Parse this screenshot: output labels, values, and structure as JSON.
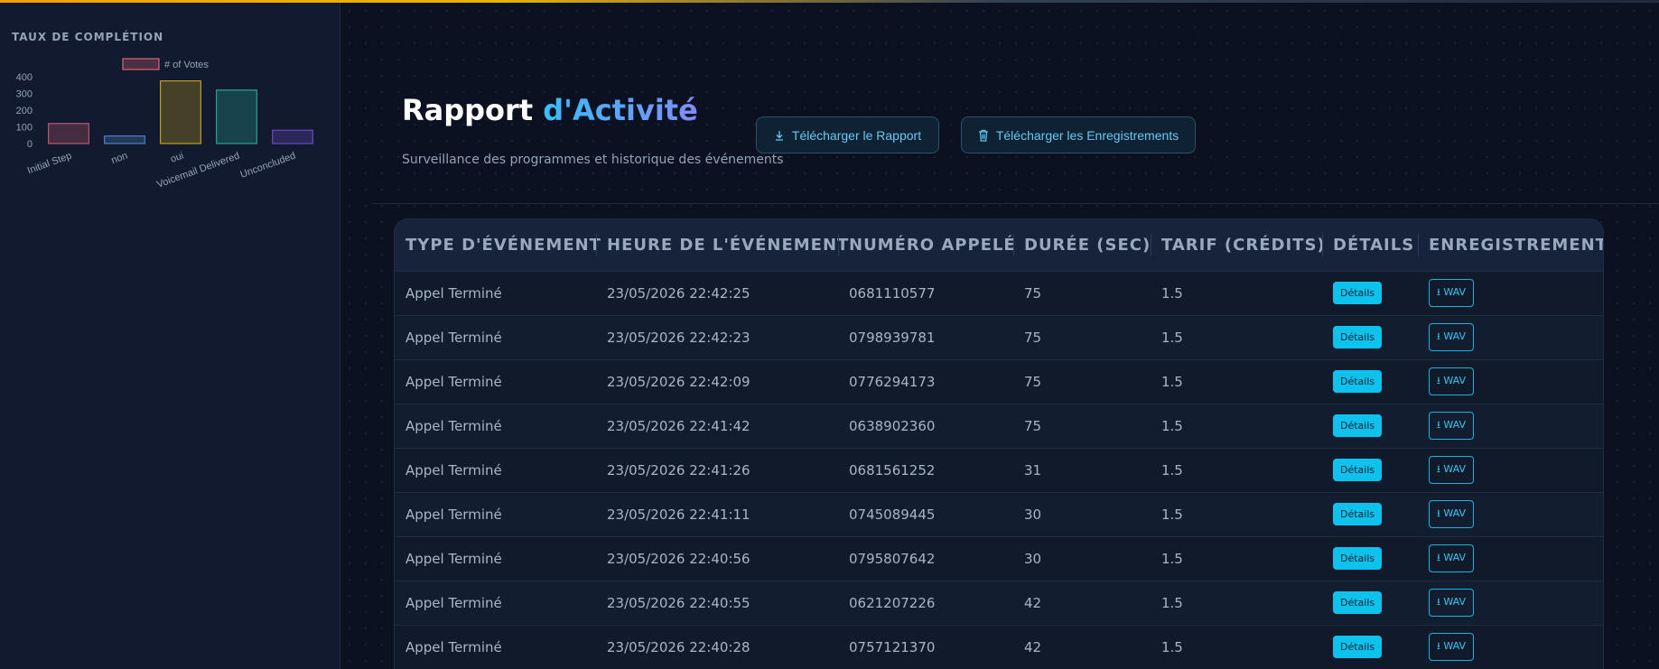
{
  "sidebar": {
    "title": "TAUX DE COMPLÉTION"
  },
  "chart_data": {
    "type": "bar",
    "legend": "# of Votes",
    "legend_position": "top",
    "categories": [
      "Initial Step",
      "non",
      "oui",
      "Voicemail Delivered",
      "Unconcluded"
    ],
    "values": [
      120,
      45,
      375,
      320,
      80
    ],
    "yticks": [
      0,
      100,
      200,
      300,
      400
    ],
    "ylim": [
      0,
      400
    ],
    "colors": [
      "#fb7185",
      "#60a5fa",
      "#facc15",
      "#2dd4bf",
      "#8b5cf6"
    ],
    "grid": false
  },
  "header": {
    "title": "Rapport",
    "title_accent": "d'Activité",
    "subtitle": "Surveillance des programmes et historique des événements",
    "download_report_label": "Télécharger le Rapport",
    "download_recordings_label": "Télécharger les Enregistrements"
  },
  "table": {
    "columns": [
      "Type d'événement",
      "Heure de l'événement",
      "Numéro appelé",
      "Durée (sec)",
      "Tarif (crédits)",
      "Détails",
      "Enregistrement"
    ],
    "details_label": "Détails",
    "wav_label": "⭳ WAV",
    "rows": [
      {
        "type": "Appel Terminé",
        "time": "23/05/2026 22:42:25",
        "number": "0681110577",
        "duration": "75",
        "rate": "1.5"
      },
      {
        "type": "Appel Terminé",
        "time": "23/05/2026 22:42:23",
        "number": "0798939781",
        "duration": "75",
        "rate": "1.5"
      },
      {
        "type": "Appel Terminé",
        "time": "23/05/2026 22:42:09",
        "number": "0776294173",
        "duration": "75",
        "rate": "1.5"
      },
      {
        "type": "Appel Terminé",
        "time": "23/05/2026 22:41:42",
        "number": "0638902360",
        "duration": "75",
        "rate": "1.5"
      },
      {
        "type": "Appel Terminé",
        "time": "23/05/2026 22:41:26",
        "number": "0681561252",
        "duration": "31",
        "rate": "1.5"
      },
      {
        "type": "Appel Terminé",
        "time": "23/05/2026 22:41:11",
        "number": "0745089445",
        "duration": "30",
        "rate": "1.5"
      },
      {
        "type": "Appel Terminé",
        "time": "23/05/2026 22:40:56",
        "number": "0795807642",
        "duration": "30",
        "rate": "1.5"
      },
      {
        "type": "Appel Terminé",
        "time": "23/05/2026 22:40:55",
        "number": "0621207226",
        "duration": "42",
        "rate": "1.5"
      },
      {
        "type": "Appel Terminé",
        "time": "23/05/2026 22:40:28",
        "number": "0757121370",
        "duration": "42",
        "rate": "1.5"
      }
    ]
  }
}
